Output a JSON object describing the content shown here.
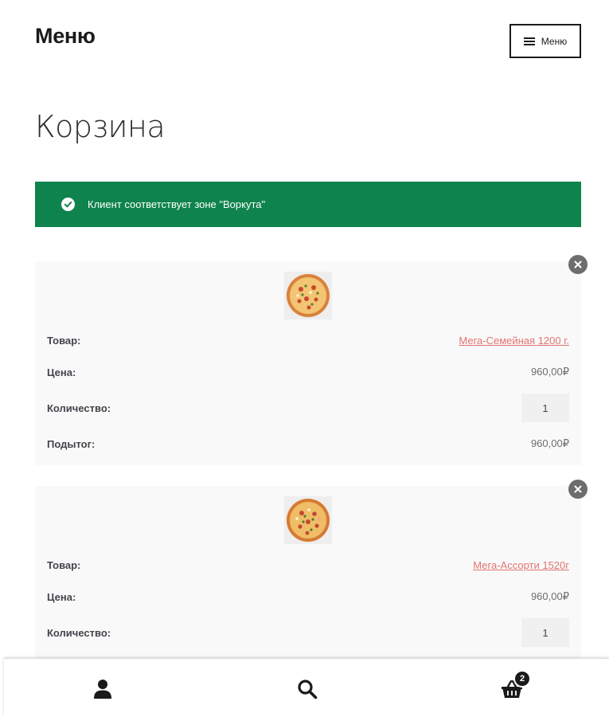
{
  "header": {
    "site_title": "Меню",
    "menu_label": "Меню"
  },
  "page_title": "Корзина",
  "notice": {
    "text": "Клиент соответствует зоне \"Воркута\"",
    "color": "#0f834d"
  },
  "labels": {
    "product": "Товар:",
    "price": "Цена:",
    "quantity": "Количество:",
    "subtotal": "Подытог:"
  },
  "cart_items": [
    {
      "name": "Мега-Семейная 1200 г.",
      "price": "960,00₽",
      "quantity": "1",
      "subtotal": "960,00₽"
    },
    {
      "name": "Мега-Ассорти 1520г",
      "price": "960,00₽",
      "quantity": "1"
    }
  ],
  "footer_bar": {
    "cart_count": "2",
    "icons": [
      "user-icon",
      "search-icon",
      "basket-icon"
    ]
  },
  "colors": {
    "accent": "#0f834d",
    "link": "#e57373",
    "text": "#43454b"
  }
}
